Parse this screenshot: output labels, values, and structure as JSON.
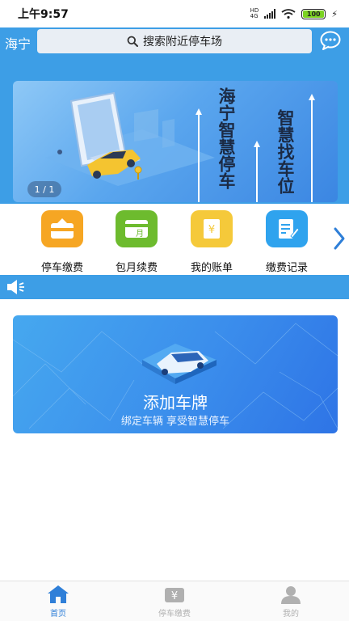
{
  "status": {
    "time": "上午9:57",
    "battery": "100"
  },
  "header": {
    "city": "海宁",
    "search_placeholder": "搜索附近停车场"
  },
  "banner": {
    "title_right": "智慧找车位",
    "title_left": "海宁智慧停车",
    "pager": "1 / 1"
  },
  "actions": [
    {
      "label": "停车缴费",
      "icon": "upload-wallet-icon",
      "color": "#f6a623"
    },
    {
      "label": "包月续费",
      "icon": "monthly-card-icon",
      "color": "#6dbb2e"
    },
    {
      "label": "我的账单",
      "icon": "yuan-bill-icon",
      "color": "#f5c93a"
    },
    {
      "label": "缴费记录",
      "icon": "record-edit-icon",
      "color": "#2fa3ee"
    }
  ],
  "add_plate": {
    "title": "添加车牌",
    "subtitle": "绑定车辆  享受智慧停车"
  },
  "tabs": [
    {
      "label": "首页",
      "icon": "home-icon",
      "active": true
    },
    {
      "label": "停车缴费",
      "icon": "parking-pay-icon",
      "active": false
    },
    {
      "label": "我的",
      "icon": "user-icon",
      "active": false
    }
  ],
  "colors": {
    "primary": "#3d9ee6",
    "tab_active": "#2f7fd8",
    "tab_inactive": "#b0b0b0"
  }
}
